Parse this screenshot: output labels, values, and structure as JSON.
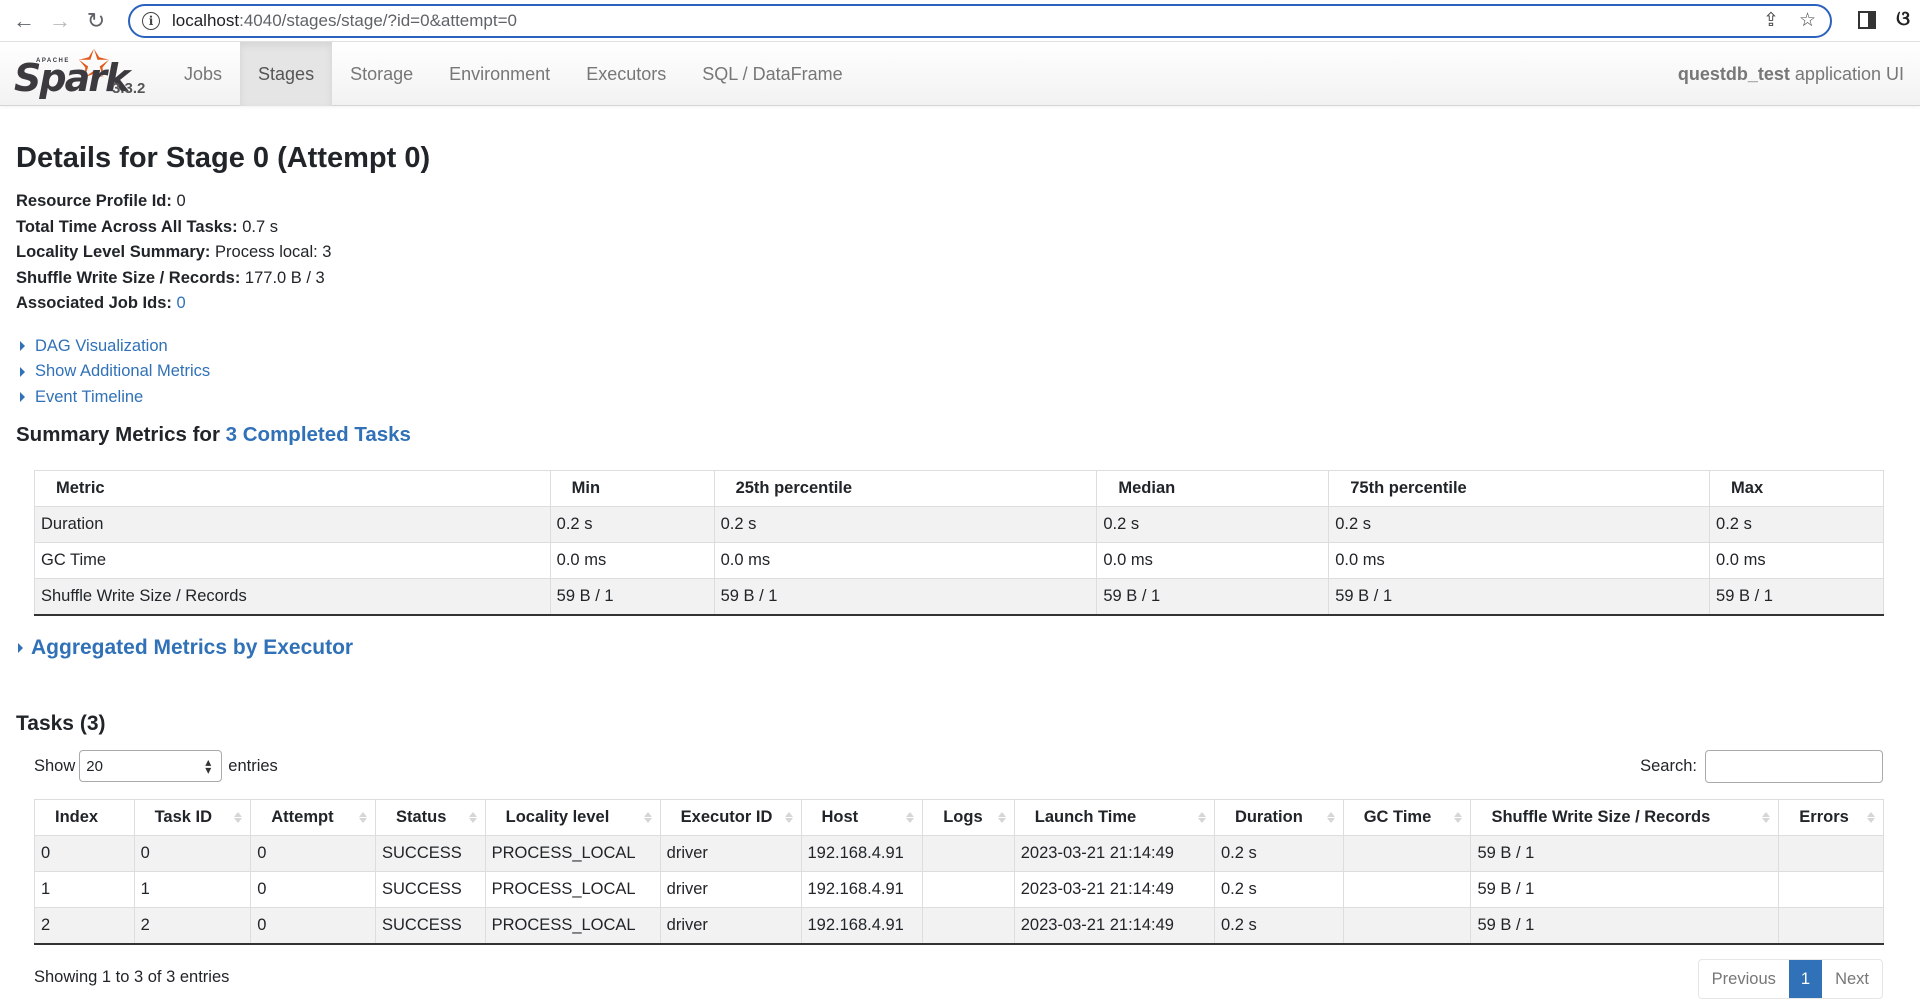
{
  "browser": {
    "url_host": "localhost",
    "url_rest": ":4040/stages/stage/?id=0&attempt=0",
    "icons": [
      "back-icon",
      "forward-icon",
      "reload-icon",
      "site-info-icon",
      "share-icon",
      "bookmark-star-icon",
      "side-panel-icon",
      "extension-icon"
    ]
  },
  "navbar": {
    "brand_apache": "APACHE",
    "brand_spark": "Spark",
    "version": "3.3.2",
    "tabs": [
      {
        "label": "Jobs",
        "active": false
      },
      {
        "label": "Stages",
        "active": true
      },
      {
        "label": "Storage",
        "active": false
      },
      {
        "label": "Environment",
        "active": false
      },
      {
        "label": "Executors",
        "active": false
      },
      {
        "label": "SQL / DataFrame",
        "active": false
      }
    ],
    "app_name": "questdb_test",
    "app_suffix": "application UI"
  },
  "page": {
    "title": "Details for Stage 0 (Attempt 0)",
    "summary": [
      {
        "label": "Resource Profile Id:",
        "value": "0"
      },
      {
        "label": "Total Time Across All Tasks:",
        "value": "0.7 s"
      },
      {
        "label": "Locality Level Summary:",
        "value": "Process local: 3"
      },
      {
        "label": "Shuffle Write Size / Records:",
        "value": "177.0 B / 3"
      },
      {
        "label": "Associated Job Ids:",
        "value": "0",
        "link": true
      }
    ],
    "toggles": [
      "DAG Visualization",
      "Show Additional Metrics",
      "Event Timeline"
    ],
    "metrics_title_prefix": "Summary Metrics for",
    "metrics_title_link": "3 Completed Tasks"
  },
  "summary_table": {
    "headers": [
      "Metric",
      "Min",
      "25th percentile",
      "Median",
      "75th percentile",
      "Max"
    ],
    "rows": [
      [
        "Duration",
        "0.2 s",
        "0.2 s",
        "0.2 s",
        "0.2 s",
        "0.2 s"
      ],
      [
        "GC Time",
        "0.0 ms",
        "0.0 ms",
        "0.0 ms",
        "0.0 ms",
        "0.0 ms"
      ],
      [
        "Shuffle Write Size / Records",
        "59 B / 1",
        "59 B / 1",
        "59 B / 1",
        "59 B / 1",
        "59 B / 1"
      ]
    ]
  },
  "aggregated": {
    "label": "Aggregated Metrics by Executor"
  },
  "tasks": {
    "title": "Tasks (3)",
    "show_label": "Show",
    "page_size": "20",
    "entries_label": "entries",
    "search_label": "Search:",
    "search_value": "",
    "headers": [
      "Index",
      "Task ID",
      "Attempt",
      "Status",
      "Locality level",
      "Executor ID",
      "Host",
      "Logs",
      "Launch Time",
      "Duration",
      "GC Time",
      "Shuffle Write Size / Records",
      "Errors"
    ],
    "rows": [
      [
        "0",
        "0",
        "0",
        "SUCCESS",
        "PROCESS_LOCAL",
        "driver",
        "192.168.4.91",
        "",
        "2023-03-21 21:14:49",
        "0.2 s",
        "",
        "59 B / 1",
        ""
      ],
      [
        "1",
        "1",
        "0",
        "SUCCESS",
        "PROCESS_LOCAL",
        "driver",
        "192.168.4.91",
        "",
        "2023-03-21 21:14:49",
        "0.2 s",
        "",
        "59 B / 1",
        ""
      ],
      [
        "2",
        "2",
        "0",
        "SUCCESS",
        "PROCESS_LOCAL",
        "driver",
        "192.168.4.91",
        "",
        "2023-03-21 21:14:49",
        "0.2 s",
        "",
        "59 B / 1",
        ""
      ]
    ],
    "info": "Showing 1 to 3 of 3 entries",
    "pagination": {
      "previous": "Previous",
      "current": "1",
      "next": "Next"
    }
  },
  "colors": {
    "link": "#3071b8",
    "spark_orange": "#e25a1c",
    "url_focus": "#2a62bd"
  }
}
